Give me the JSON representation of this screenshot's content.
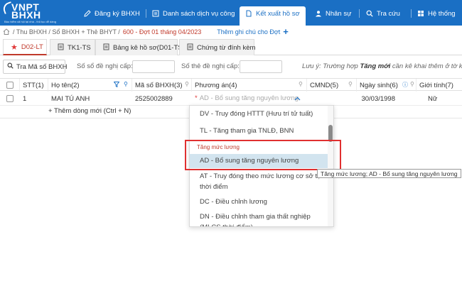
{
  "logo": {
    "line1": "VNPT",
    "line2": "BHXH",
    "slogan": "Bảo hiểm xã hội tại nhà - thủ tục dễ dàng"
  },
  "nav": [
    {
      "label": "Đăng ký BHXH",
      "icon": "pencil-icon"
    },
    {
      "label": "Danh sách dịch vụ công",
      "icon": "list-icon"
    },
    {
      "label": "Kết xuất hồ sơ",
      "icon": "document-icon",
      "active": true
    },
    {
      "label": "Nhân sự",
      "icon": "user-icon"
    },
    {
      "label": "Tra cứu",
      "icon": "search-icon"
    },
    {
      "label": "Hệ thống",
      "icon": "grid-icon"
    }
  ],
  "breadcrumb": {
    "path": "/ Thu BHXH / Sổ BHXH + Thẻ BHYT /",
    "current": "600 - Đợt 01 tháng 04/2023",
    "add_note": "Thêm ghi chú cho Đợt"
  },
  "tabs": [
    {
      "label": "D02-LT",
      "active": true
    },
    {
      "label": "TK1-TS"
    },
    {
      "label": "Bảng kê hồ sơ(D01-TS)"
    },
    {
      "label": "Chứng từ đính kèm"
    }
  ],
  "filter": {
    "search_button": "Tra Mã số BHXH",
    "proposal_no_label": "Số sổ đề nghị cấp:",
    "card_no_label": "Số thẻ đề nghị cấp:",
    "note_prefix": "Lưu ý: Trường hợp",
    "note_bold": "Tăng mới",
    "note_suffix": "cần kê khai thêm ở tờ khai TK"
  },
  "table": {
    "columns": [
      "STT(1)",
      "Họ tên(2)",
      "Mã số BHXH(3)",
      "Phương án(4)",
      "CMND(5)",
      "Ngày sinh(6)",
      "Giới tính(7)"
    ],
    "rows": [
      {
        "stt": "1",
        "name": "MAI TÚ ANH",
        "bhxh": "2525002889",
        "plan_placeholder": "AD - Bổ sung tăng nguyên lương",
        "dob": "30/03/1998",
        "gender": "Nữ"
      }
    ],
    "add_row": "+ Thêm dòng mới (Ctrl + N)"
  },
  "dropdown": {
    "options": [
      {
        "label": "DV - Truy đóng HTTT (Hưu trí tử tuất)"
      },
      {
        "label": "TL - Tăng tham gia TNLĐ, BNN"
      },
      {
        "label": "Tăng mức lương",
        "group": true
      },
      {
        "label": "AD - Bổ sung tăng nguyên lương",
        "selected": true
      },
      {
        "label": "AT - Truy đóng theo mức lương cơ sở tại thời điểm"
      },
      {
        "label": "DC - Điều chỉnh lương"
      },
      {
        "label": "DN - Điều chỉnh tham gia thất nghiệp (MLCS thời điểm)"
      }
    ]
  },
  "tooltip": "Tăng mức lương; AD - Bổ sung tăng nguyên lương",
  "colors": {
    "nav_bg": "#1a6fc4",
    "accent_red": "#c0392b",
    "selected_bg": "#d2e4ef"
  }
}
